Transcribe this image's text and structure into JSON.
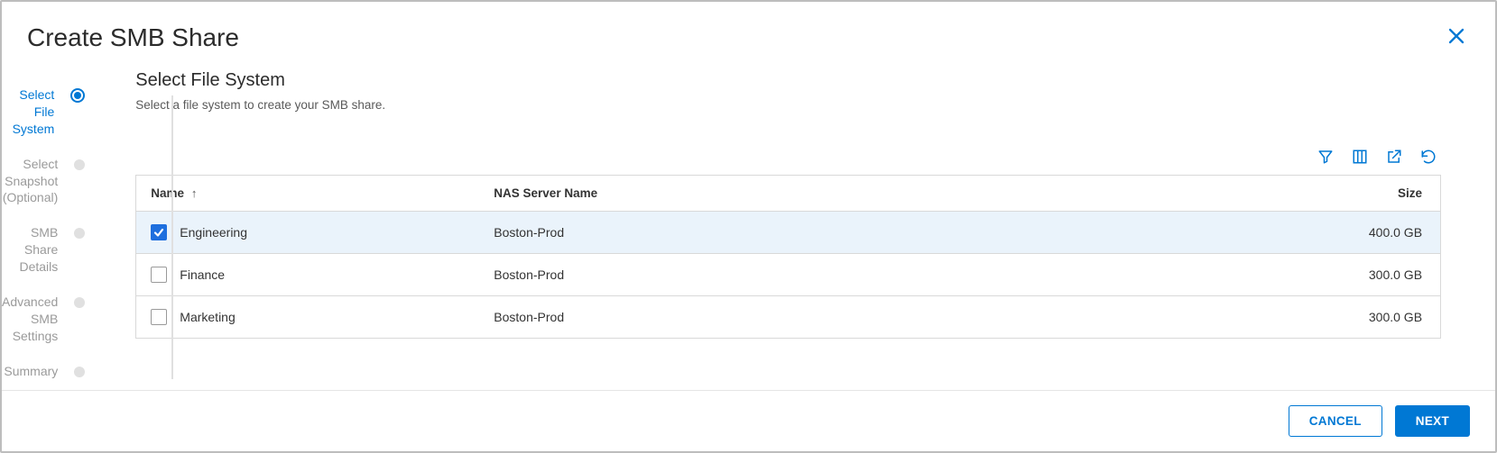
{
  "modal": {
    "title": "Create SMB Share",
    "close_icon": "close"
  },
  "wizard": {
    "steps": [
      {
        "label": "Select File System",
        "active": true
      },
      {
        "label": "Select Snapshot (Optional)",
        "active": false
      },
      {
        "label": "SMB Share Details",
        "active": false
      },
      {
        "label": "Advanced SMB Settings",
        "active": false
      },
      {
        "label": "Summary",
        "active": false
      }
    ]
  },
  "content": {
    "title": "Select File System",
    "subtitle": "Select a file system to create your SMB share."
  },
  "toolbar": {
    "filter": "Filter",
    "columns": "Columns",
    "export": "Export",
    "refresh": "Refresh"
  },
  "table": {
    "headers": {
      "name": "Name",
      "nas": "NAS Server Name",
      "size": "Size"
    },
    "sort_asc_icon": "↑",
    "rows": [
      {
        "name": "Engineering",
        "nas": "Boston-Prod",
        "size": "400.0 GB",
        "selected": true
      },
      {
        "name": "Finance",
        "nas": "Boston-Prod",
        "size": "300.0 GB",
        "selected": false
      },
      {
        "name": "Marketing",
        "nas": "Boston-Prod",
        "size": "300.0 GB",
        "selected": false
      }
    ]
  },
  "footer": {
    "cancel": "Cancel",
    "next": "Next"
  }
}
